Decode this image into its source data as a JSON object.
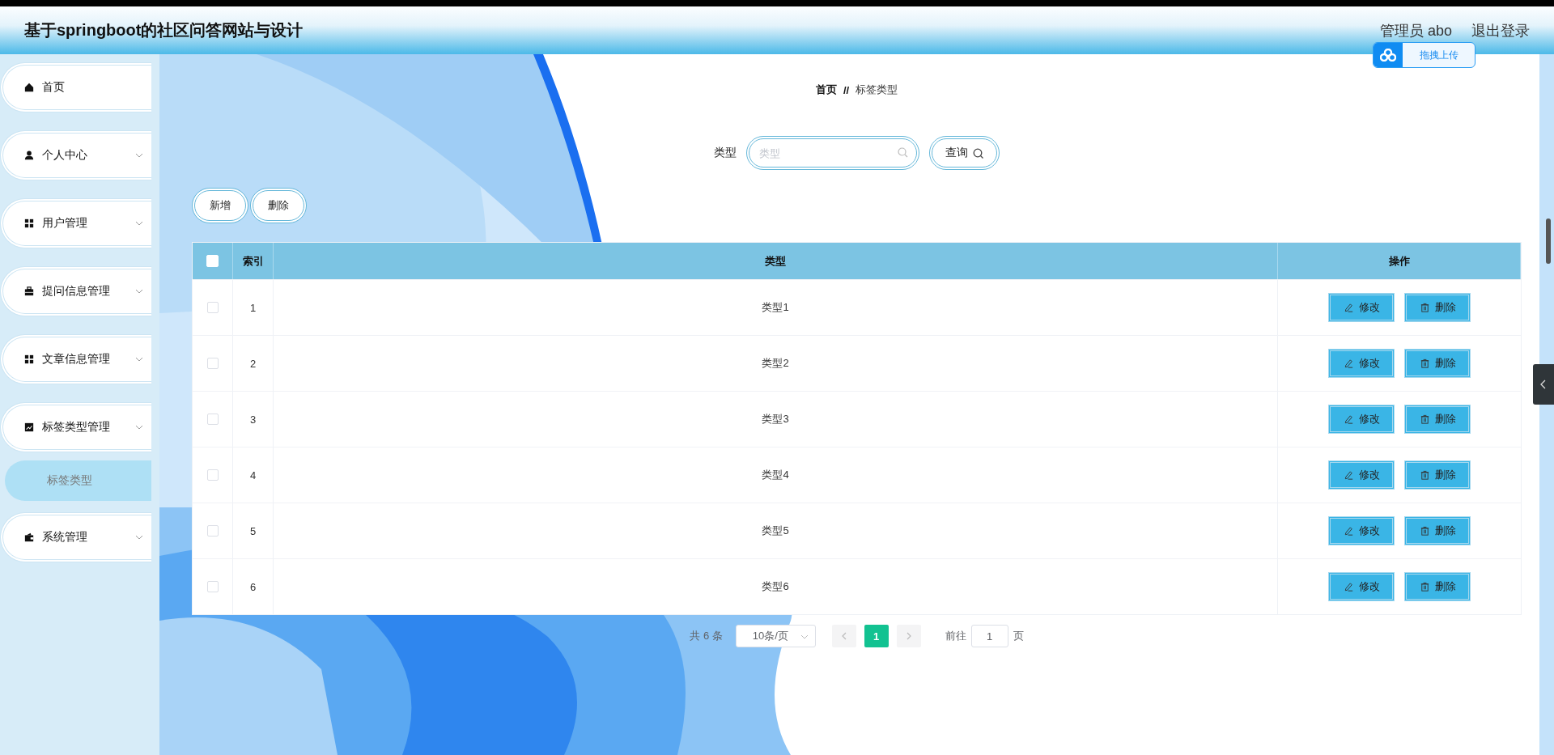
{
  "header": {
    "title": "基于springboot的社区问答网站与设计",
    "user": "管理员 abo",
    "logout": "退出登录"
  },
  "upload_widget": {
    "label": "拖拽上传"
  },
  "sidebar": {
    "items": [
      {
        "label": "首页",
        "expandable": false
      },
      {
        "label": "个人中心",
        "expandable": true
      },
      {
        "label": "用户管理",
        "expandable": true
      },
      {
        "label": "提问信息管理",
        "expandable": true
      },
      {
        "label": "文章信息管理",
        "expandable": true
      },
      {
        "label": "标签类型管理",
        "expandable": true,
        "children": [
          {
            "label": "标签类型",
            "selected": true
          }
        ]
      },
      {
        "label": "系统管理",
        "expandable": true
      }
    ]
  },
  "breadcrumb": {
    "items": [
      "首页",
      "标签类型"
    ],
    "separator": "//"
  },
  "search": {
    "label": "类型",
    "placeholder": "类型",
    "button": "查询"
  },
  "actions": [
    "新增",
    "删除"
  ],
  "table": {
    "select_all": {
      "checked": false
    },
    "columns": [
      "索引",
      "类型",
      "操作"
    ],
    "rows": [
      {
        "checked": false,
        "index": "1",
        "type": "类型1",
        "actions": [
          "修改",
          "删除"
        ]
      },
      {
        "checked": false,
        "index": "2",
        "type": "类型2",
        "actions": [
          "修改",
          "删除"
        ]
      },
      {
        "checked": false,
        "index": "3",
        "type": "类型3",
        "actions": [
          "修改",
          "删除"
        ]
      },
      {
        "checked": false,
        "index": "4",
        "type": "类型4",
        "actions": [
          "修改",
          "删除"
        ]
      },
      {
        "checked": false,
        "index": "5",
        "type": "类型5",
        "actions": [
          "修改",
          "删除"
        ]
      },
      {
        "checked": false,
        "index": "6",
        "type": "类型6",
        "actions": [
          "修改",
          "删除"
        ]
      }
    ]
  },
  "pagination": {
    "total": "共 6 条",
    "page_size": "10条/页",
    "pages": [
      {
        "label": "1",
        "selected": true
      }
    ],
    "goto_label": "前往",
    "goto_value": "1",
    "goto_suffix": "页"
  }
}
